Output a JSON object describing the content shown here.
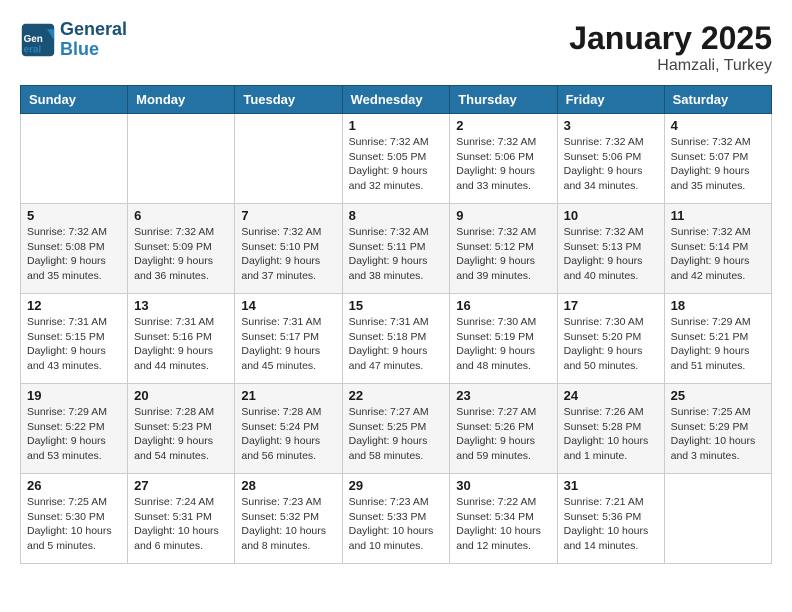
{
  "header": {
    "logo_line1": "General",
    "logo_line2": "Blue",
    "month_year": "January 2025",
    "location": "Hamzali, Turkey"
  },
  "weekdays": [
    "Sunday",
    "Monday",
    "Tuesday",
    "Wednesday",
    "Thursday",
    "Friday",
    "Saturday"
  ],
  "weeks": [
    [
      {
        "day": "",
        "info": ""
      },
      {
        "day": "",
        "info": ""
      },
      {
        "day": "",
        "info": ""
      },
      {
        "day": "1",
        "info": "Sunrise: 7:32 AM\nSunset: 5:05 PM\nDaylight: 9 hours\nand 32 minutes."
      },
      {
        "day": "2",
        "info": "Sunrise: 7:32 AM\nSunset: 5:06 PM\nDaylight: 9 hours\nand 33 minutes."
      },
      {
        "day": "3",
        "info": "Sunrise: 7:32 AM\nSunset: 5:06 PM\nDaylight: 9 hours\nand 34 minutes."
      },
      {
        "day": "4",
        "info": "Sunrise: 7:32 AM\nSunset: 5:07 PM\nDaylight: 9 hours\nand 35 minutes."
      }
    ],
    [
      {
        "day": "5",
        "info": "Sunrise: 7:32 AM\nSunset: 5:08 PM\nDaylight: 9 hours\nand 35 minutes."
      },
      {
        "day": "6",
        "info": "Sunrise: 7:32 AM\nSunset: 5:09 PM\nDaylight: 9 hours\nand 36 minutes."
      },
      {
        "day": "7",
        "info": "Sunrise: 7:32 AM\nSunset: 5:10 PM\nDaylight: 9 hours\nand 37 minutes."
      },
      {
        "day": "8",
        "info": "Sunrise: 7:32 AM\nSunset: 5:11 PM\nDaylight: 9 hours\nand 38 minutes."
      },
      {
        "day": "9",
        "info": "Sunrise: 7:32 AM\nSunset: 5:12 PM\nDaylight: 9 hours\nand 39 minutes."
      },
      {
        "day": "10",
        "info": "Sunrise: 7:32 AM\nSunset: 5:13 PM\nDaylight: 9 hours\nand 40 minutes."
      },
      {
        "day": "11",
        "info": "Sunrise: 7:32 AM\nSunset: 5:14 PM\nDaylight: 9 hours\nand 42 minutes."
      }
    ],
    [
      {
        "day": "12",
        "info": "Sunrise: 7:31 AM\nSunset: 5:15 PM\nDaylight: 9 hours\nand 43 minutes."
      },
      {
        "day": "13",
        "info": "Sunrise: 7:31 AM\nSunset: 5:16 PM\nDaylight: 9 hours\nand 44 minutes."
      },
      {
        "day": "14",
        "info": "Sunrise: 7:31 AM\nSunset: 5:17 PM\nDaylight: 9 hours\nand 45 minutes."
      },
      {
        "day": "15",
        "info": "Sunrise: 7:31 AM\nSunset: 5:18 PM\nDaylight: 9 hours\nand 47 minutes."
      },
      {
        "day": "16",
        "info": "Sunrise: 7:30 AM\nSunset: 5:19 PM\nDaylight: 9 hours\nand 48 minutes."
      },
      {
        "day": "17",
        "info": "Sunrise: 7:30 AM\nSunset: 5:20 PM\nDaylight: 9 hours\nand 50 minutes."
      },
      {
        "day": "18",
        "info": "Sunrise: 7:29 AM\nSunset: 5:21 PM\nDaylight: 9 hours\nand 51 minutes."
      }
    ],
    [
      {
        "day": "19",
        "info": "Sunrise: 7:29 AM\nSunset: 5:22 PM\nDaylight: 9 hours\nand 53 minutes."
      },
      {
        "day": "20",
        "info": "Sunrise: 7:28 AM\nSunset: 5:23 PM\nDaylight: 9 hours\nand 54 minutes."
      },
      {
        "day": "21",
        "info": "Sunrise: 7:28 AM\nSunset: 5:24 PM\nDaylight: 9 hours\nand 56 minutes."
      },
      {
        "day": "22",
        "info": "Sunrise: 7:27 AM\nSunset: 5:25 PM\nDaylight: 9 hours\nand 58 minutes."
      },
      {
        "day": "23",
        "info": "Sunrise: 7:27 AM\nSunset: 5:26 PM\nDaylight: 9 hours\nand 59 minutes."
      },
      {
        "day": "24",
        "info": "Sunrise: 7:26 AM\nSunset: 5:28 PM\nDaylight: 10 hours\nand 1 minute."
      },
      {
        "day": "25",
        "info": "Sunrise: 7:25 AM\nSunset: 5:29 PM\nDaylight: 10 hours\nand 3 minutes."
      }
    ],
    [
      {
        "day": "26",
        "info": "Sunrise: 7:25 AM\nSunset: 5:30 PM\nDaylight: 10 hours\nand 5 minutes."
      },
      {
        "day": "27",
        "info": "Sunrise: 7:24 AM\nSunset: 5:31 PM\nDaylight: 10 hours\nand 6 minutes."
      },
      {
        "day": "28",
        "info": "Sunrise: 7:23 AM\nSunset: 5:32 PM\nDaylight: 10 hours\nand 8 minutes."
      },
      {
        "day": "29",
        "info": "Sunrise: 7:23 AM\nSunset: 5:33 PM\nDaylight: 10 hours\nand 10 minutes."
      },
      {
        "day": "30",
        "info": "Sunrise: 7:22 AM\nSunset: 5:34 PM\nDaylight: 10 hours\nand 12 minutes."
      },
      {
        "day": "31",
        "info": "Sunrise: 7:21 AM\nSunset: 5:36 PM\nDaylight: 10 hours\nand 14 minutes."
      },
      {
        "day": "",
        "info": ""
      }
    ]
  ]
}
